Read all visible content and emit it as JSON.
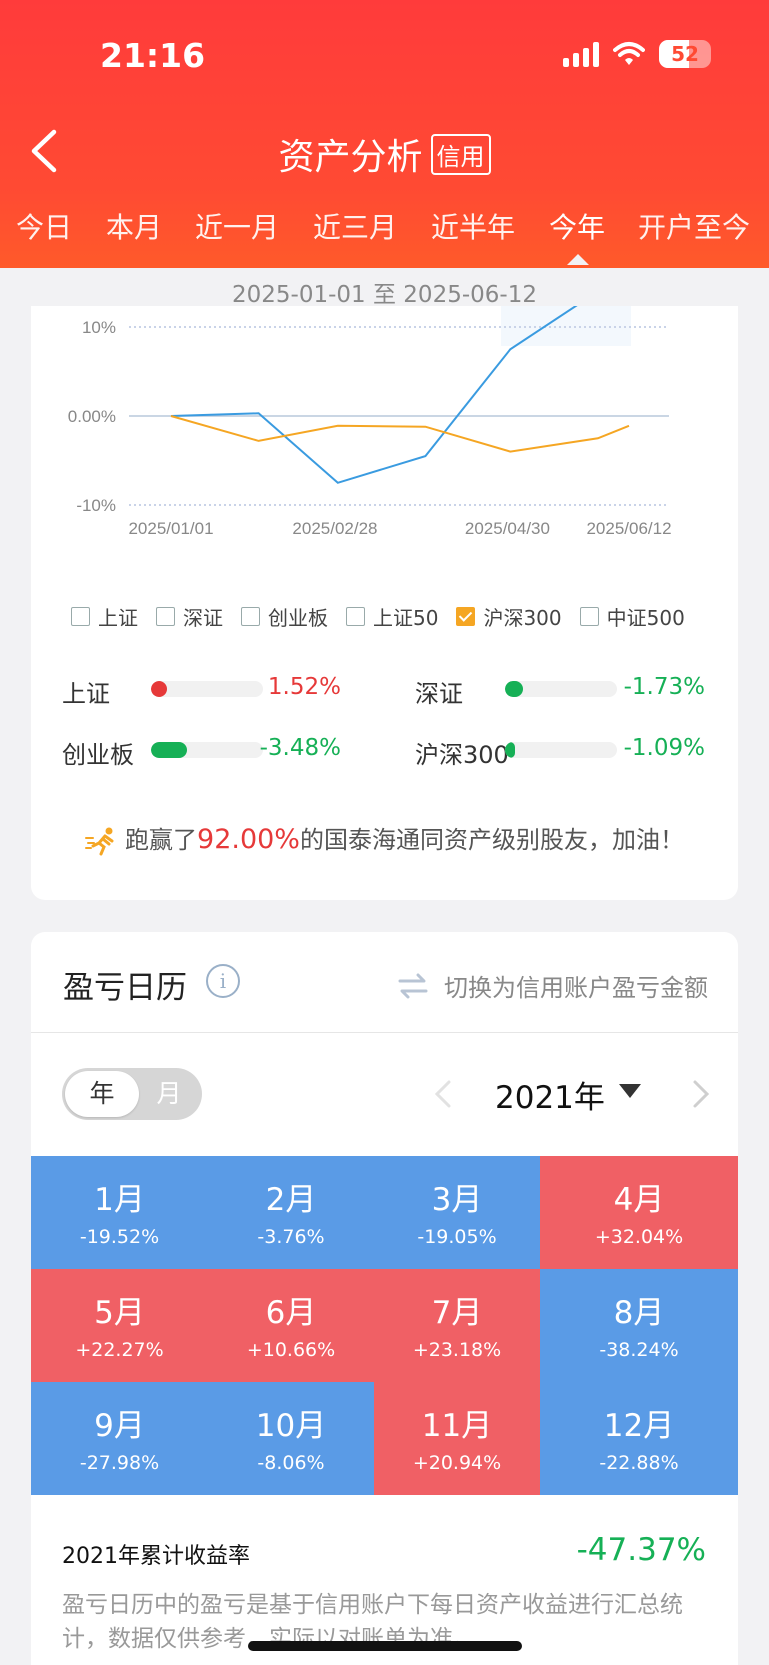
{
  "status": {
    "time": "21:16",
    "battery": "52"
  },
  "nav": {
    "title": "资产分析",
    "badge": "信用"
  },
  "tabs": [
    "今日",
    "本月",
    "近一月",
    "近三月",
    "近半年",
    "今年",
    "开户至今"
  ],
  "active_tab": "今年",
  "date_range": "2025-01-01 至 2025-06-12",
  "chart_data": {
    "type": "line",
    "y_ticks": [
      "10%",
      "0.00%",
      "-10%"
    ],
    "x_ticks": [
      "2025/01/01",
      "2025/02/28",
      "2025/04/30",
      "2025/06/12"
    ],
    "ylim": [
      -10,
      10
    ],
    "series": [
      {
        "color": "#3a9be0",
        "x": [
          "2025/01/01",
          "2025/02/01",
          "2025/03/01",
          "2025/04/01",
          "2025/05/01",
          "2025/06/01"
        ],
        "y": [
          0,
          0.3,
          -7.5,
          -4.5,
          7.5,
          14
        ]
      },
      {
        "color": "#f5a623",
        "x": [
          "2025/01/01",
          "2025/02/01",
          "2025/03/01",
          "2025/04/01",
          "2025/05/01",
          "2025/06/01",
          "2025/06/12"
        ],
        "y": [
          0,
          -2.8,
          -1.1,
          -1.2,
          -4.0,
          -2.5,
          -1.1
        ]
      }
    ]
  },
  "legend": [
    {
      "label": "上证",
      "checked": false
    },
    {
      "label": "深证",
      "checked": false
    },
    {
      "label": "创业板",
      "checked": false
    },
    {
      "label": "上证50",
      "checked": false
    },
    {
      "label": "沪深300",
      "checked": true
    },
    {
      "label": "中证500",
      "checked": false
    }
  ],
  "indices": [
    {
      "name": "上证",
      "value": "1.52%",
      "fill_fraction": 0.14,
      "trend": "up"
    },
    {
      "name": "深证",
      "value": "-1.73%",
      "fill_fraction": 0.16,
      "trend": "down"
    },
    {
      "name": "创业板",
      "value": "-3.48%",
      "fill_fraction": 0.32,
      "trend": "down"
    },
    {
      "name": "沪深300",
      "value": "-1.09%",
      "fill_fraction": 0.09,
      "trend": "down"
    }
  ],
  "beat": {
    "prefix": "跑赢了",
    "percent": "92.00%",
    "suffix": "的国泰海通同资产级别股友，加油！"
  },
  "calendar": {
    "title": "盈亏日历",
    "switch_label": "切换为信用账户盈亏金额",
    "toggle_year": "年",
    "toggle_month": "月",
    "year": "2021年",
    "months": [
      {
        "month": "1月",
        "pct": "-19.52%",
        "color": "#5a9be6"
      },
      {
        "month": "2月",
        "pct": "-3.76%",
        "color": "#5a9be6"
      },
      {
        "month": "3月",
        "pct": "-19.05%",
        "color": "#5a9be6"
      },
      {
        "month": "4月",
        "pct": "+32.04%",
        "color": "#f06065"
      },
      {
        "month": "5月",
        "pct": "+22.27%",
        "color": "#f06065"
      },
      {
        "month": "6月",
        "pct": "+10.66%",
        "color": "#f06065"
      },
      {
        "month": "7月",
        "pct": "+23.18%",
        "color": "#f06065"
      },
      {
        "month": "8月",
        "pct": "-38.24%",
        "color": "#5a9be6"
      },
      {
        "month": "9月",
        "pct": "-27.98%",
        "color": "#5a9be6"
      },
      {
        "month": "10月",
        "pct": "-8.06%",
        "color": "#5a9be6"
      },
      {
        "month": "11月",
        "pct": "+20.94%",
        "color": "#f06065"
      },
      {
        "month": "12月",
        "pct": "-22.88%",
        "color": "#5a9be6"
      }
    ],
    "cumulative_label": "2021年累计收益率",
    "cumulative_value": "-47.37%",
    "note": "盈亏日历中的盈亏是基于信用账户下每日资产收益进行汇总统计，数据仅供参考，实际以对账单为准。"
  }
}
